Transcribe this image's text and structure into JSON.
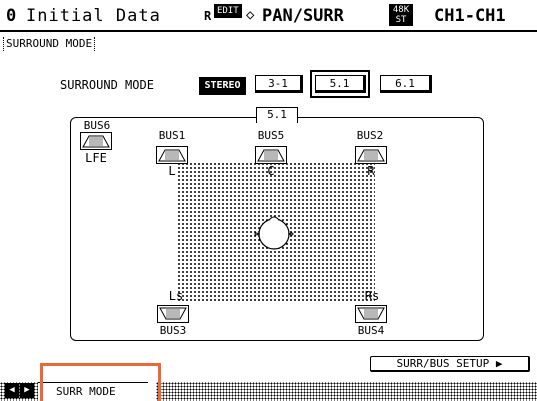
{
  "title_bar": {
    "scene_number": "0",
    "scene_name": "Initial Data",
    "r_indicator": "R",
    "edit_badge": "EDIT",
    "screen_title": "PAN/SURR",
    "fs_top": "48K",
    "fs_bottom": "ST",
    "channel": "CH1-CH1"
  },
  "mode_tag": "SURROUND MODE",
  "surround_mode": {
    "label": "SURROUND MODE",
    "options": [
      "STEREO",
      "3-1",
      "5.1",
      "6.1"
    ],
    "selected": "5.1"
  },
  "pan_display": {
    "mode_label": "5.1",
    "speakers": {
      "lfe": {
        "bus": "BUS6",
        "channel": "LFE"
      },
      "left": {
        "bus": "BUS1",
        "channel": "L"
      },
      "center": {
        "bus": "BUS5",
        "channel": "C"
      },
      "right": {
        "bus": "BUS2",
        "channel": "R"
      },
      "left_surround": {
        "bus": "BUS3",
        "channel": "Ls"
      },
      "right_surround": {
        "bus": "BUS4",
        "channel": "Rs"
      }
    }
  },
  "setup_button": "SURR/BUS SETUP",
  "tabs": [
    {
      "label": "SURR MODE"
    }
  ],
  "colors": {
    "highlight": "#e96a36",
    "foreground": "#000000",
    "background": "#ffffff"
  }
}
